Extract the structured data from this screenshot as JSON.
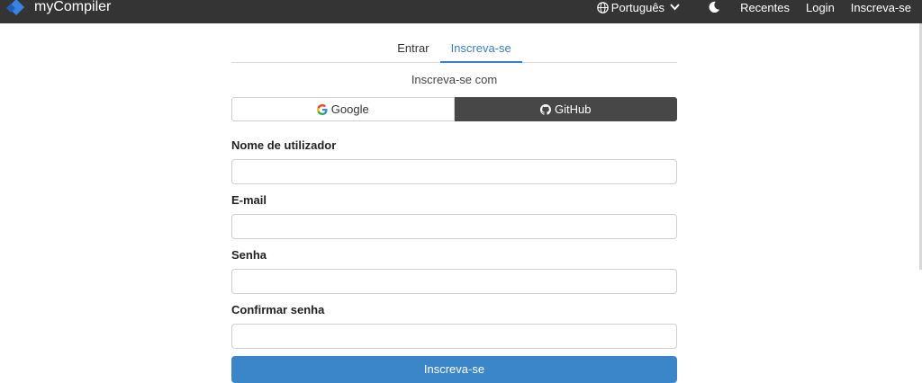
{
  "navbar": {
    "brand": "myCompiler",
    "language": "Português",
    "links": [
      "Recentes",
      "Login",
      "Inscreva-se"
    ]
  },
  "tabs": [
    {
      "label": "Entrar",
      "active": false
    },
    {
      "label": "Inscreva-se",
      "active": true
    }
  ],
  "signup_with": "Inscreva-se com",
  "oauth": {
    "google": "Google",
    "github": "GitHub"
  },
  "form": {
    "username_label": "Nome de utilizador",
    "email_label": "E-mail",
    "password_label": "Senha",
    "confirm_label": "Confirmar senha",
    "username_value": "",
    "email_value": "",
    "password_value": "",
    "confirm_value": "",
    "submit": "Inscreva-se"
  },
  "colors": {
    "accent": "#3a7fc4",
    "navbar": "#343434",
    "github": "#474747",
    "submit": "#3a86c8"
  }
}
